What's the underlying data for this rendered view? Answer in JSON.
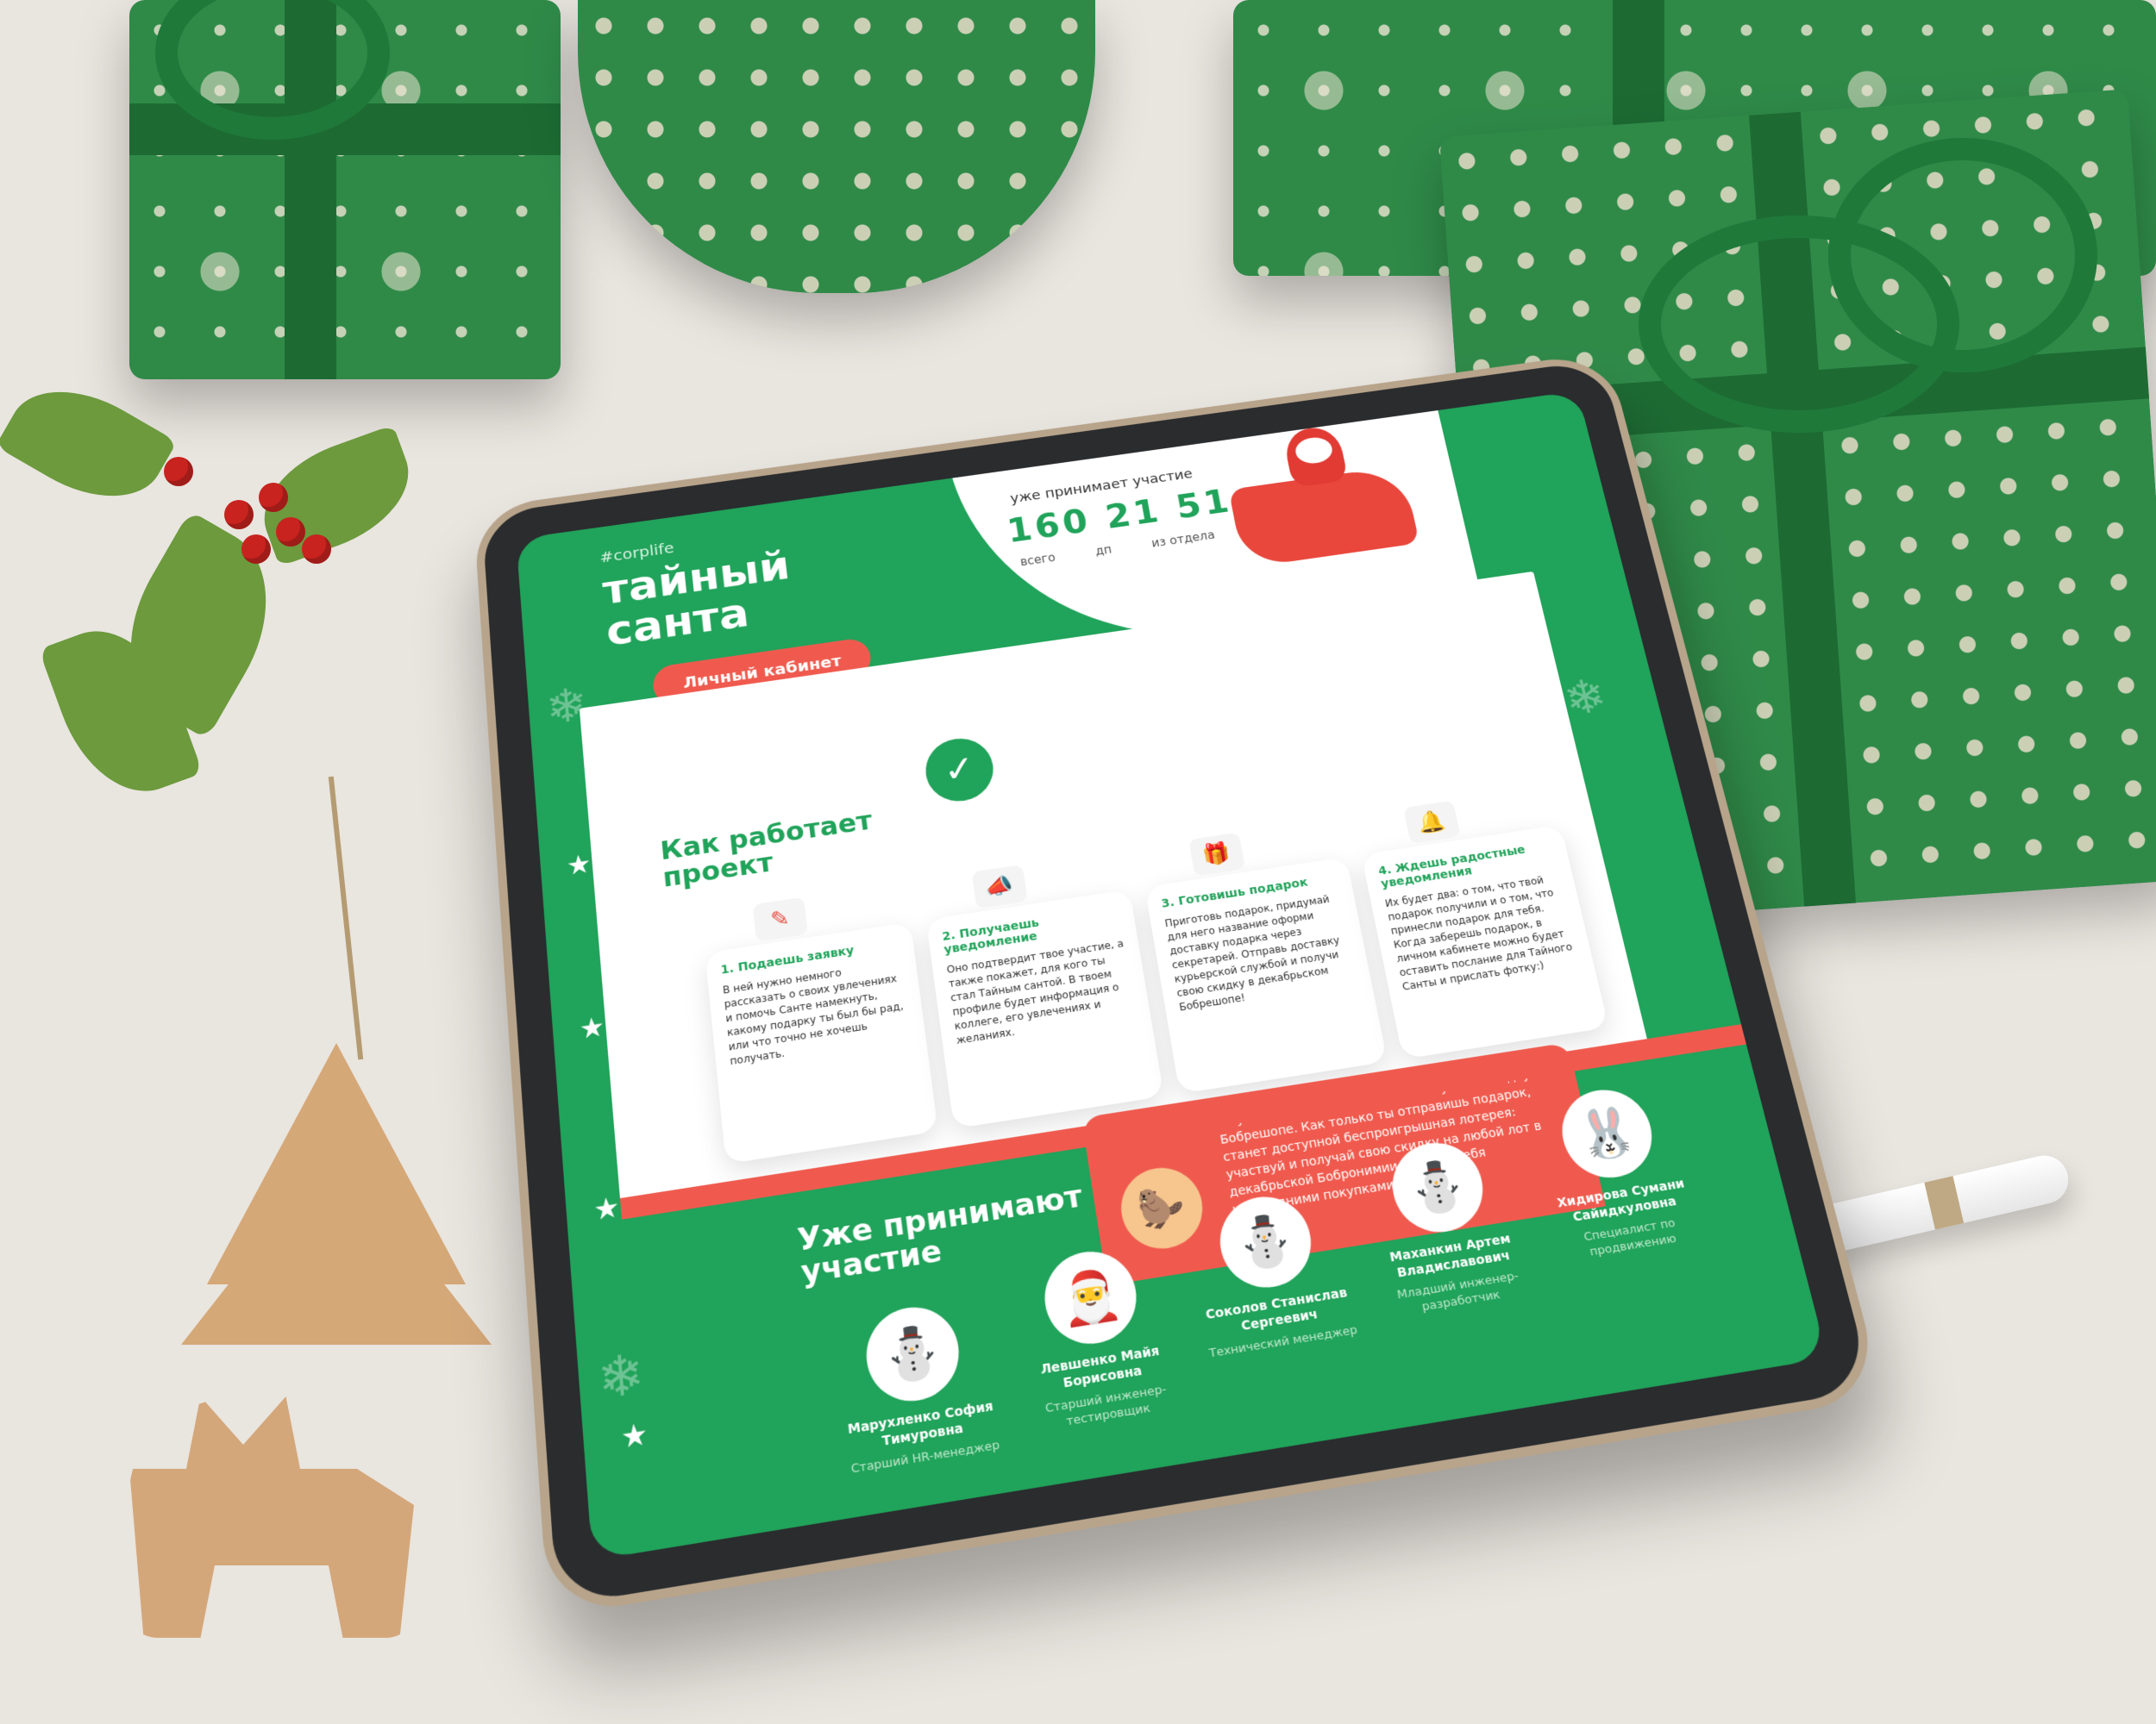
{
  "page": {
    "tag": "#corplife",
    "title": "тайный санта",
    "cabinet_button": "Личный кабинет"
  },
  "counter": {
    "label": "уже принимает участие",
    "numbers": "160 21 51",
    "subs": [
      "всего",
      "дп",
      "из отдела"
    ]
  },
  "how": {
    "title": "Как работает проект",
    "steps": [
      {
        "title": "1. Подаешь заявку",
        "text": "В ней нужно немного рассказать о своих увлечениях и помочь Санте намекнуть, какому подарку ты был бы рад, или что точно не хочешь получать.",
        "icon": "form-icon"
      },
      {
        "title": "2. Получаешь уведомление",
        "text": "Оно подтвердит твое участие, а также покажет, для кого ты стал Тайным сантой. В твоем профиле будет информация о коллеге, его увлечениях и желаниях.",
        "icon": "megaphone-icon"
      },
      {
        "title": "3. Готовишь подарок",
        "text": "Приготовь подарок, придумай для него название оформи доставку подарка через секретарей. Отправь доставку курьерской службой и получи свою скидку в декабрьском Бобрешопе!",
        "icon": "gift-icon"
      },
      {
        "title": "4. Ждешь радостные уведомления",
        "text": "Их будет два: о том, что твой подарок получили и о том, что принесли подарок для тебя. Когда заберешь подарок, в личном кабинете можно будет оставить послание для Тайного Санты и прислать фотку:)",
        "icon": "bell-icon"
      }
    ]
  },
  "promo": {
    "text": "За участие в Тайном Санте ты получишь скидку в Бобрешопе. Как только ты отправишь подарок, станет доступной беспроигрышная лотерея: участвуй и получай свою скидку на любой лот в декабрьской Бобронимии и радуй себя новогодними покупками за бобры!"
  },
  "participants": {
    "title": "Уже принимают участие",
    "people": [
      {
        "name": "Марухленко София Тимуровна",
        "role": "Старший HR-менеджер",
        "avatar": "snowman"
      },
      {
        "name": "Левшенко Майя Борисовна",
        "role": "Старший инженер-тестировщик",
        "avatar": "santa"
      },
      {
        "name": "Соколов Станислав Сергеевич",
        "role": "Технический менеджер",
        "avatar": "snowman"
      },
      {
        "name": "Маханкин Артем Владиславович",
        "role": "Младший инженер-разработчик",
        "avatar": "snowman"
      },
      {
        "name": "Хидирова Сумани Сайидкуловна",
        "role": "Специалист по продвижению",
        "avatar": "bunny"
      }
    ]
  },
  "colors": {
    "brand_green": "#20a35a",
    "accent_red": "#f05a4e"
  }
}
